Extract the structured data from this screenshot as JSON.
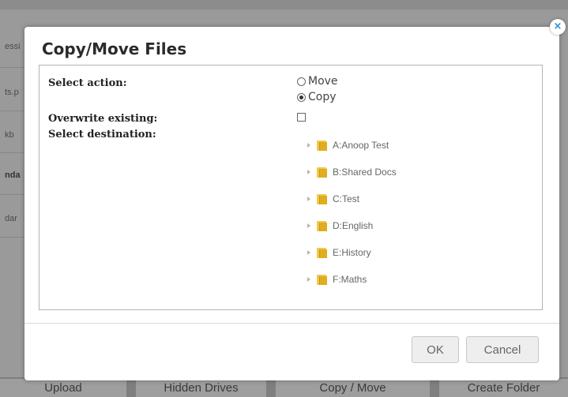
{
  "background": {
    "left_labels": [
      "essi",
      "ts.p",
      "kb",
      "nda",
      "dar"
    ],
    "toolbar": [
      "Upload",
      "Hidden Drives",
      "Copy / Move",
      "Create Folder"
    ]
  },
  "dialog": {
    "title": "Copy/Move Files",
    "close_glyph": "×",
    "select_action_label": "Select action:",
    "action_options": [
      {
        "label": "Move",
        "selected": false
      },
      {
        "label": "Copy",
        "selected": true
      }
    ],
    "overwrite_label": "Overwrite existing:",
    "overwrite_checked": false,
    "destination_label": "Select destination:",
    "folders": [
      "A:Anoop Test",
      "B:Shared Docs",
      "C:Test",
      "D:English",
      "E:History",
      "F:Maths"
    ],
    "ok_label": "OK",
    "cancel_label": "Cancel"
  },
  "colors": {
    "overlay": "#9a9a9a",
    "accent_close": "#2a8fd6",
    "folder": "#f2c84b"
  },
  "icons": {
    "close": "close-icon",
    "folder": "folder-icon",
    "expand": "expand-arrow-icon"
  }
}
